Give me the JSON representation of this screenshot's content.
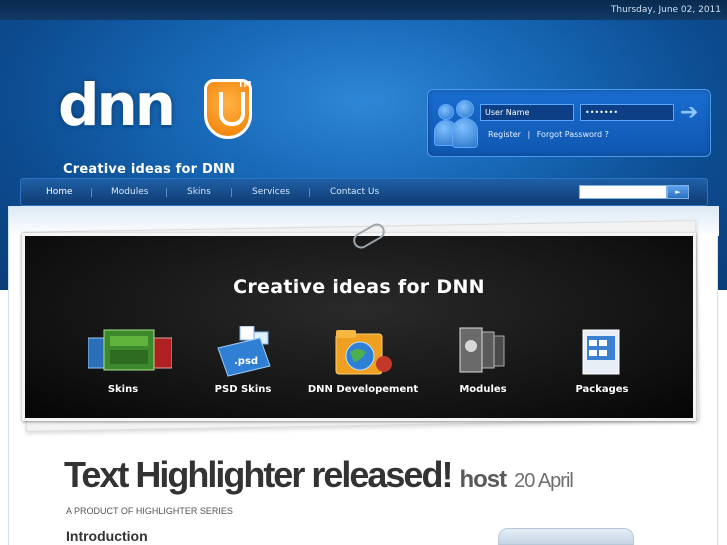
{
  "topbar": {
    "date": "Thursday, June 02, 2011"
  },
  "header": {
    "logo_text": "dnn",
    "trademark": "TM",
    "tagline": "Creative ideas for DNN"
  },
  "login": {
    "username_value": "User Name",
    "password_value": "•••••••",
    "register_label": "Register",
    "separator": "|",
    "forgot_label": "Forgot Password ?"
  },
  "nav": {
    "items": [
      {
        "label": "Home"
      },
      {
        "label": "Modules"
      },
      {
        "label": "Skins"
      },
      {
        "label": "Services"
      },
      {
        "label": "Contact Us"
      }
    ],
    "search_button": "►"
  },
  "banner": {
    "title": "Creative ideas for DNN",
    "products": [
      {
        "label": "Skins",
        "icon": "skins-icon"
      },
      {
        "label": "PSD Skins",
        "icon": "psd-icon"
      },
      {
        "label": "DNN Developement",
        "icon": "folder-globe-icon"
      },
      {
        "label": "Modules",
        "icon": "modules-icon"
      },
      {
        "label": "Packages",
        "icon": "packages-icon"
      }
    ]
  },
  "post": {
    "title": "Text Highlighter released!",
    "author": "host",
    "date": "20 April",
    "subtitle": "A PRODUCT OF HIGHLIGHTER SERIES",
    "section": "Introduction"
  },
  "colors": {
    "header_blue": "#1768b6",
    "accent_orange": "#f07d00",
    "banner_black": "#111111"
  }
}
